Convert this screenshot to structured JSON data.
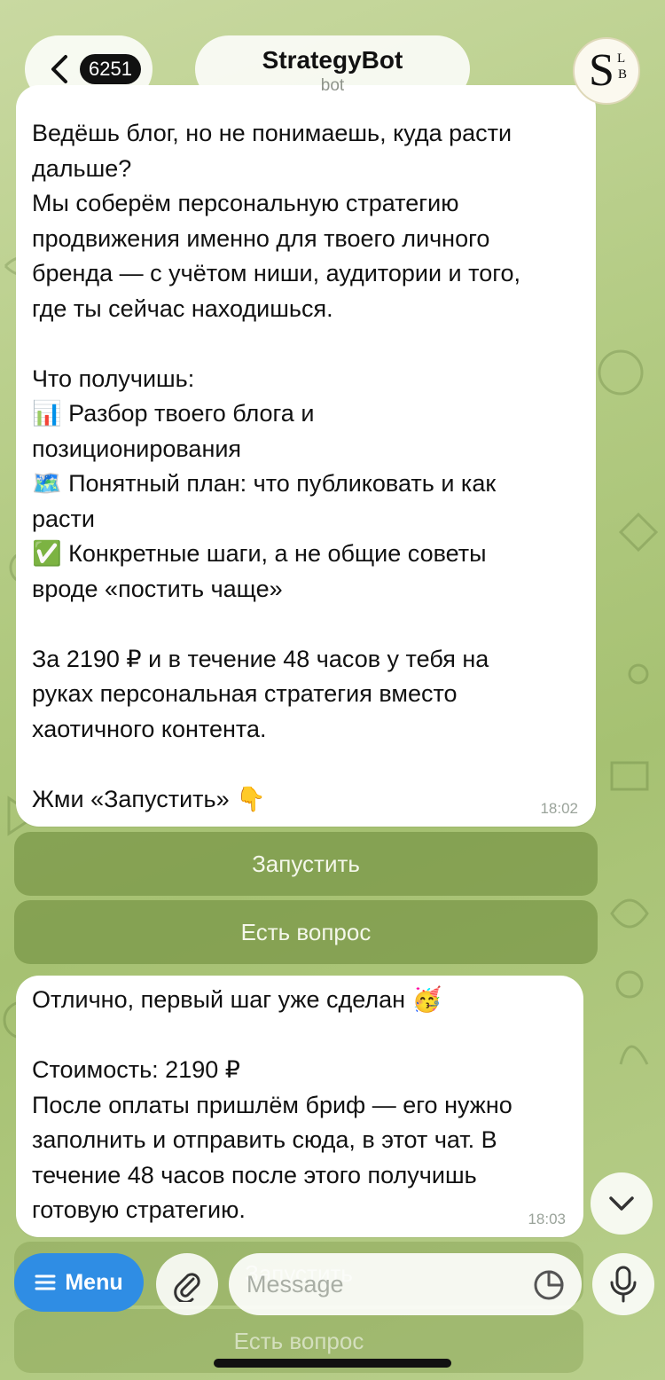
{
  "header": {
    "back_count": "6251",
    "title": "StrategyBot",
    "subtitle": "bot",
    "avatar_letters": {
      "main": "S",
      "top": "L",
      "bottom": "B"
    }
  },
  "messages": [
    {
      "text": "Ведёшь блог, но не понимаешь, куда расти\nдальше?\nМы соберём персональную стратегию\nпродвижения именно для твоего личного\nбренда — с учётом ниши, аудитории и того,\nгде ты сейчас находишься.\n\nЧто получишь:\n📊 Разбор твоего блога и\nпозиционирования\n🗺️ Понятный план: что публиковать и как\nрасти\n✅ Конкретные шаги, а не общие советы\nвроде «постить чаще»\n\nЗа 2190 ₽ и в течение 48 часов у тебя на\nруках персональная стратегия вместо\nхаотичного контента.\n\nЖми «Запустить» 👇",
      "time": "18:02"
    },
    {
      "text": "Отлично, первый шаг уже сделан 🥳\n\nСтоимость: 2190 ₽\nПосле оплаты пришлём бриф — его нужно\nзаполнить и отправить сюда, в этот чат. В\nтечение 48 часов после этого получишь\nготовую стратегию.",
      "time": "18:03"
    }
  ],
  "keyboard": {
    "buttons": [
      "Запустить",
      "Есть вопрос"
    ],
    "ghost_buttons": [
      "Запустить",
      "Есть вопрос"
    ]
  },
  "composer": {
    "menu_label": "Menu",
    "placeholder": "Message"
  },
  "icons": {
    "back": "chevron-left-icon",
    "menu": "hamburger-icon",
    "attach": "paperclip-icon",
    "sticker": "sticker-icon",
    "mic": "microphone-icon",
    "scroll_down": "chevron-down-icon"
  },
  "colors": {
    "menu_button": "#2f8de4",
    "keyboard_button": "#7f9a48",
    "bubble": "#ffffff",
    "background": "#b3cb83"
  }
}
